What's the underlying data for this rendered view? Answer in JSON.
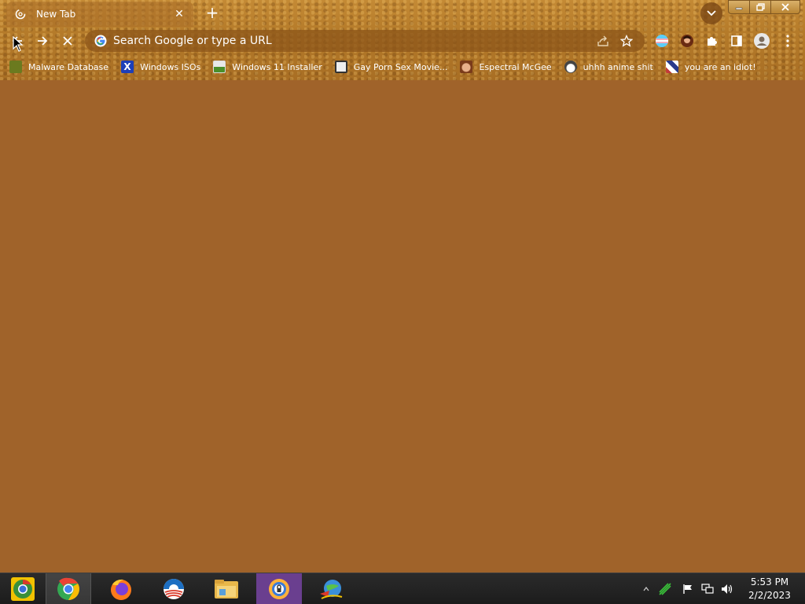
{
  "tab": {
    "title": "New Tab"
  },
  "omnibox": {
    "placeholder": "Search Google or type a URL"
  },
  "bookmarks": [
    {
      "label": "Malware Database",
      "icon": "bug-icon",
      "color": "#6b7a1f"
    },
    {
      "label": "Windows ISOs",
      "icon": "x-icon",
      "color": "#1d3fb8"
    },
    {
      "label": "Windows 11 Installer",
      "icon": "image-icon",
      "color": "#4a8f2a"
    },
    {
      "label": "Gay Porn Sex Movie...",
      "icon": "cube-icon",
      "color": "#333333"
    },
    {
      "label": "Espectral McGee",
      "icon": "character-icon",
      "color": "#7a3b1a"
    },
    {
      "label": "uhhh anime shit",
      "icon": "anime-icon",
      "color": "#444444"
    },
    {
      "label": "you are an idiot!",
      "icon": "flag-icon",
      "color": "#c23a3a"
    }
  ],
  "taskbar": {
    "apps": [
      "chrome-canary-icon",
      "chrome-icon",
      "firefox-icon",
      "obama-logo-icon",
      "file-explorer-icon",
      "browser-lock-icon",
      "idm-icon"
    ]
  },
  "clock": {
    "time": "5:53 PM",
    "date": "2/2/2023"
  }
}
